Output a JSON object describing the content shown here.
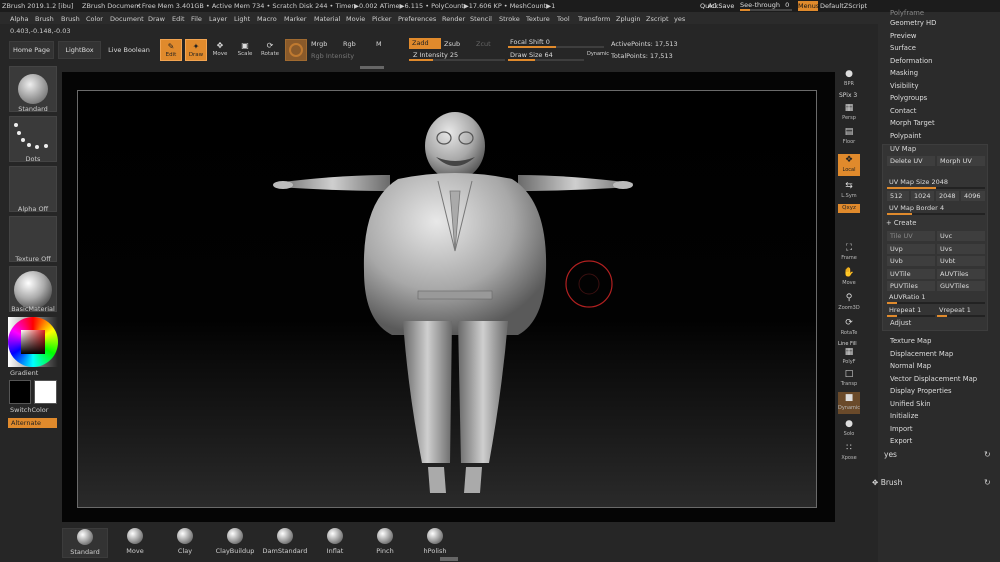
{
  "titlebar": {
    "app": "ZBrush 2019.1.2 [ibu]",
    "document": "ZBrush Document",
    "stats": "• Free Mem 3.401GB • Active Mem 734 • Scratch Disk 244 • Timer▶0.002 ATime▶6.115 • PolyCount▶17.606 KP • MeshCount▶1",
    "ac": "AC",
    "quicksave": "QuickSave",
    "see_through": "See-through",
    "see_through_value": "0",
    "menus": "Menus",
    "default_zscript": "DefaultZScript"
  },
  "menubar": [
    "Alpha",
    "Brush",
    "Brush",
    "Color",
    "Document",
    "Draw",
    "Edit",
    "File",
    "Layer",
    "Light",
    "Macro",
    "Marker",
    "Material",
    "Movie",
    "Picker",
    "Preferences",
    "Render",
    "Stencil",
    "Stroke",
    "Texture",
    "Tool",
    "Transform",
    "Zplugin",
    "Zscript",
    "yes"
  ],
  "shelf": {
    "coords": "0.403,-0.148,-0.03",
    "home_page": "Home Page",
    "lightbox": "LightBox",
    "live_boolean": "Live Boolean",
    "edit": "Edit",
    "draw": "Draw",
    "move": "Move",
    "scale": "Scale",
    "rotate": "Rotate",
    "mrgb": "Mrgb",
    "rgb": "Rgb",
    "m": "M",
    "rgb_intensity": "Rgb Intensity",
    "zadd": "Zadd",
    "zsub": "Zsub",
    "zcut": "Zcut",
    "z_intensity_label": "Z Intensity",
    "z_intensity_value": "25",
    "focal_shift_label": "Focal Shift",
    "focal_shift_value": "0",
    "draw_size_label": "Draw Size",
    "draw_size_value": "64",
    "dynamic": "Dynamic",
    "active_points": "ActivePoints: 17,513",
    "total_points": "TotalPoints: 17,513"
  },
  "leftpanel": {
    "standard": "Standard",
    "dots": "Dots",
    "alpha_off": "Alpha Off",
    "texture_off": "Texture Off",
    "basic_material": "BasicMaterial",
    "gradient": "Gradient",
    "switch_color": "SwitchColor",
    "alternate": "Alternate"
  },
  "rightstrip": {
    "bpr": "BPR",
    "spix": "SPix 3",
    "dynamic": "Dynamic",
    "persp": "Persp",
    "floor": "Floor",
    "local": "Local",
    "lsym": "L.Sym",
    "qxyz": "Qxyz",
    "frame": "Frame",
    "move": "Move",
    "zoom3d": "Zoom3D",
    "rotate": "RotaTe",
    "line_fill": "Line Fill",
    "polyf": "PolyF",
    "transp": "Transp",
    "dynamic2": "Dynamic",
    "solo": "Solo",
    "xpose": "Xpose"
  },
  "palette": {
    "top_cut": "Polyframe",
    "items_top": [
      "Geometry HD",
      "Preview",
      "Surface",
      "Deformation",
      "Masking",
      "Visibility",
      "Polygroups",
      "Contact",
      "Morph Target",
      "Polypaint"
    ],
    "uv_map": {
      "title": "UV Map",
      "delete_uv": "Delete UV",
      "morph_uv": "Morph UV",
      "size_label": "UV Map Size",
      "size_value": "2048",
      "sizes": [
        "512",
        "1024",
        "2048",
        "4096"
      ],
      "border_label": "UV Map Border",
      "border_value": "4",
      "create": "Create",
      "buttons": [
        "Uvp",
        "Uvs",
        "Uvb",
        "Uvbt",
        "UVTile",
        "AUVTiles",
        "PUVTiles",
        "GUVTiles"
      ],
      "tile_uv": "Tile UV",
      "uvc": "Uvc",
      "auv_ratio_label": "AUVRatio",
      "auv_ratio_value": "1",
      "hrepeat_label": "Hrepeat",
      "hrepeat_value": "1",
      "vrepeat_label": "Vrepeat",
      "vrepeat_value": "1",
      "adjust": "Adjust"
    },
    "items_bottom": [
      "Texture Map",
      "Displacement Map",
      "Normal Map",
      "Vector Displacement Map",
      "Display Properties",
      "Unified Skin",
      "Initialize",
      "Import",
      "Export"
    ],
    "yes": "yes",
    "brush": "Brush"
  },
  "bottom_brushes": [
    "Standard",
    "Move",
    "Clay",
    "ClayBuildup",
    "DamStandard",
    "Inflat",
    "Pinch",
    "hPolish"
  ],
  "colors": {
    "accent": "#e08a2c",
    "background": "#262626",
    "viewport": "#050505"
  }
}
